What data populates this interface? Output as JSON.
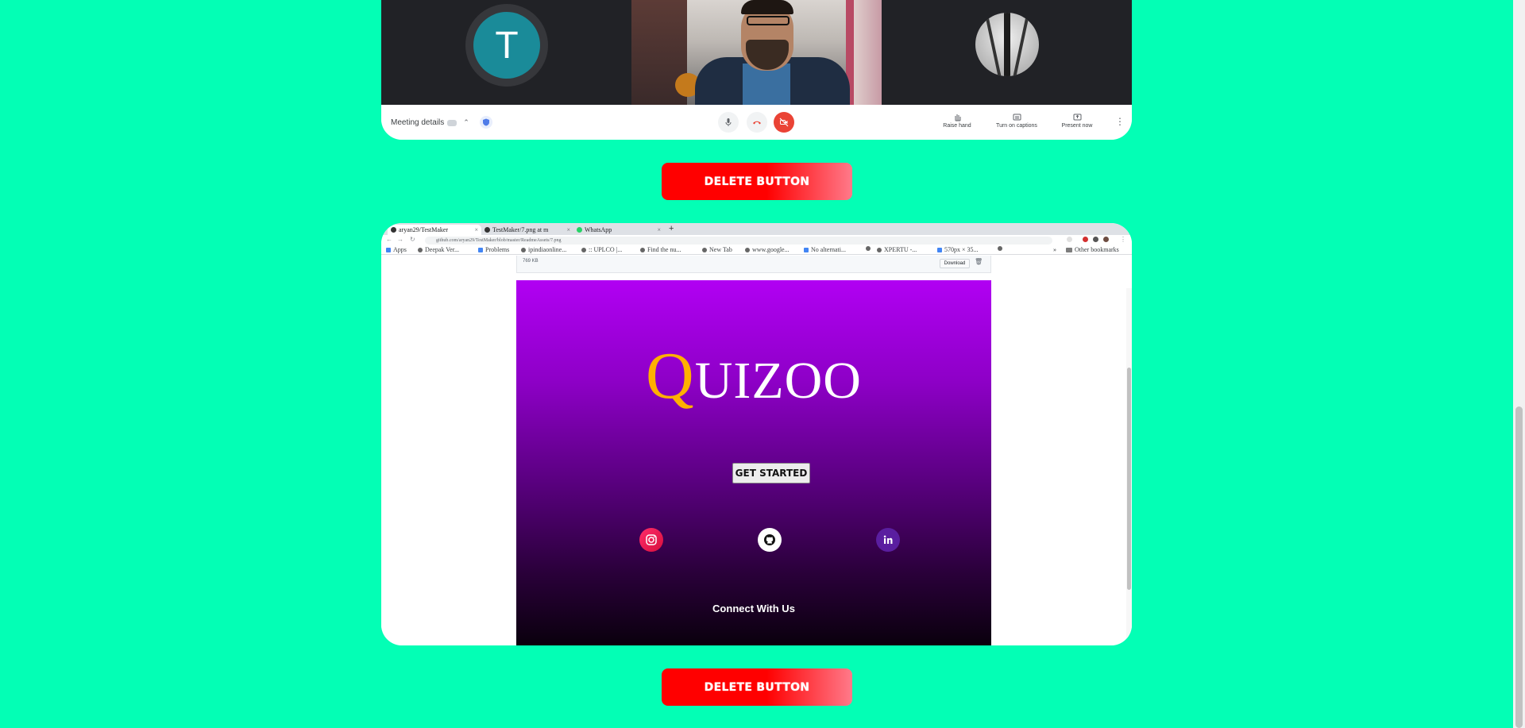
{
  "meeting": {
    "participant_initial": "T",
    "details_label": "Meeting details",
    "raise_hand": "Raise hand",
    "captions": "Turn on captions",
    "present": "Present now"
  },
  "delete_buttons": [
    "DELETE BUTTON",
    "DELETE BUTTON"
  ],
  "browser": {
    "tabs": [
      {
        "label": "aryan29/TestMaker",
        "icon": "github-icon"
      },
      {
        "label": "TestMaker/7.png at m",
        "icon": "github-icon"
      },
      {
        "label": "WhatsApp",
        "icon": "whatsapp-icon"
      }
    ],
    "url": "github.com/aryan29/TestMaker/blob/master/ReadmeAssets/7.png",
    "bookmarks": [
      "Apps",
      "Deepak Ver...",
      "Problems",
      "ipindiaonline...",
      ":: UPLCO |...",
      "Find the nu...",
      "New Tab",
      "www.google...",
      "No alternati...",
      "XPERTU -...",
      "570px × 35..."
    ],
    "other_bookmarks": "Other bookmarks",
    "file_size": "769 KB",
    "download_label": "Download"
  },
  "quizoo": {
    "logo_first": "Q",
    "logo_rest": "UIZOO",
    "cta": "GET STARTED",
    "connect": "Connect With Us"
  },
  "colors": {
    "page_bg": "#03ffb5",
    "delete_red": "#ff0000",
    "quizoo_purple": "#b100f3",
    "logo_gold": "#ffb000"
  }
}
